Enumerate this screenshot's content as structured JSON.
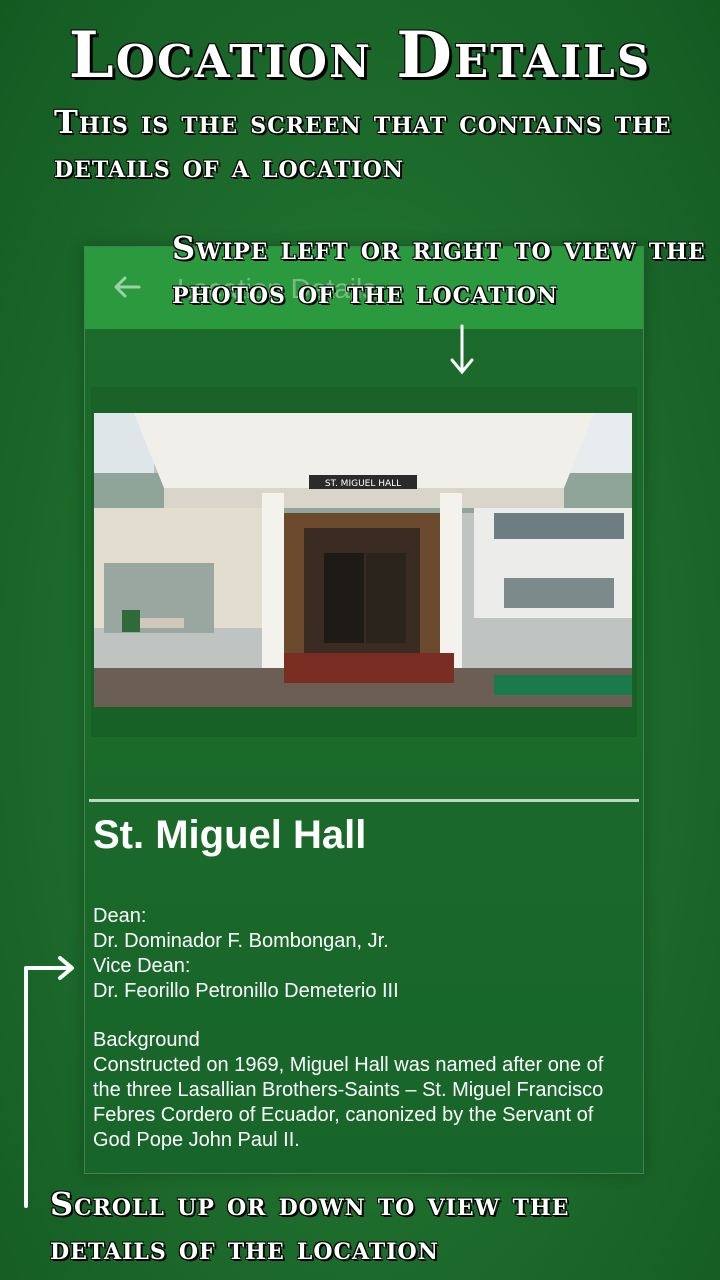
{
  "banner": {
    "title": "Location Details",
    "subtitle": "This is the screen that contains the details of a location"
  },
  "hints": {
    "swipe": "Swipe left or right to view the photos of the location",
    "scroll": "Scroll up or down to view the details of the location"
  },
  "app_bar": {
    "title": "Location Details",
    "back_icon": "arrow-left-icon"
  },
  "location": {
    "name": "St. Miguel Hall",
    "photo_sign": "ST. MIGUEL HALL",
    "people": "Dean:\nDr. Dominador F. Bombongan, Jr.\nVice Dean:\nDr. Feorillo Petronillo Demeterio III",
    "background": "Background\nConstructed on 1969, Miguel Hall was named after one of the three Lasallian Brothers-Saints – St. Miguel Francisco Febres Cordero of Ecuador, canonized by the Servant of God Pope John Paul II."
  },
  "colors": {
    "background": "#1f6f2e",
    "app_bar": "#2b9a3f",
    "text": "#ffffff"
  }
}
